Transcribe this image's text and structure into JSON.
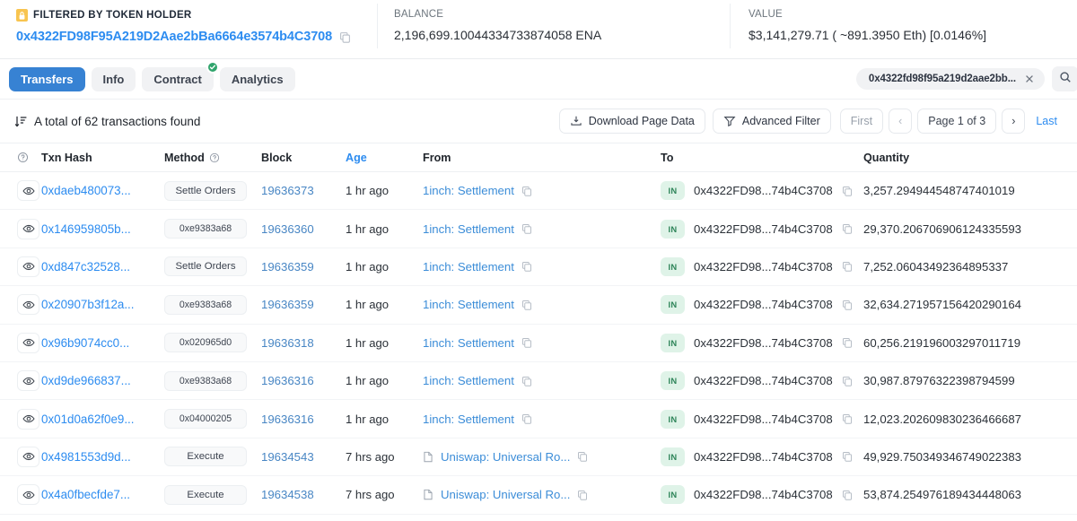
{
  "summary": {
    "filter_label": "FILTERED BY TOKEN HOLDER",
    "filter_address": "0x4322FD98F95A219D2Aae2bBa6664e3574b4C3708",
    "balance_label": "BALANCE",
    "balance_value": "2,196,699.10044334733874058 ENA",
    "value_label": "VALUE",
    "value_value": "$3,141,279.71 ( ~891.3950 Eth) [0.0146%]"
  },
  "tabs": [
    {
      "label": "Transfers",
      "active": true,
      "verified": false
    },
    {
      "label": "Info",
      "active": false,
      "verified": false
    },
    {
      "label": "Contract",
      "active": false,
      "verified": true
    },
    {
      "label": "Analytics",
      "active": false,
      "verified": false
    }
  ],
  "search": {
    "value": "0x4322fd98f95a219d2aae2bb...",
    "clear_label": "×"
  },
  "toolbar": {
    "total_text": "A total of 62 transactions found",
    "download_label": "Download Page Data",
    "advanced_filter_label": "Advanced Filter",
    "first_label": "First",
    "prev_label": "‹",
    "page_label": "Page 1 of 3",
    "next_label": "›",
    "last_label": "Last"
  },
  "table": {
    "columns": [
      "",
      "Txn Hash",
      "Method",
      "Block",
      "Age",
      "From",
      "To",
      "Quantity"
    ],
    "rows": [
      {
        "hash": "0xdaeb480073...",
        "method": "Settle Orders",
        "method_hex": false,
        "block": "19636373",
        "age": "1 hr ago",
        "from": "1inch: Settlement",
        "from_doc": false,
        "direction": "IN",
        "to": "0x4322FD98...74b4C3708",
        "quantity": "3,257.294944548747401019"
      },
      {
        "hash": "0x146959805b...",
        "method": "0xe9383a68",
        "method_hex": true,
        "block": "19636360",
        "age": "1 hr ago",
        "from": "1inch: Settlement",
        "from_doc": false,
        "direction": "IN",
        "to": "0x4322FD98...74b4C3708",
        "quantity": "29,370.206706906124335593"
      },
      {
        "hash": "0xd847c32528...",
        "method": "Settle Orders",
        "method_hex": false,
        "block": "19636359",
        "age": "1 hr ago",
        "from": "1inch: Settlement",
        "from_doc": false,
        "direction": "IN",
        "to": "0x4322FD98...74b4C3708",
        "quantity": "7,252.06043492364895337"
      },
      {
        "hash": "0x20907b3f12a...",
        "method": "0xe9383a68",
        "method_hex": true,
        "block": "19636359",
        "age": "1 hr ago",
        "from": "1inch: Settlement",
        "from_doc": false,
        "direction": "IN",
        "to": "0x4322FD98...74b4C3708",
        "quantity": "32,634.271957156420290164"
      },
      {
        "hash": "0x96b9074cc0...",
        "method": "0x020965d0",
        "method_hex": true,
        "block": "19636318",
        "age": "1 hr ago",
        "from": "1inch: Settlement",
        "from_doc": false,
        "direction": "IN",
        "to": "0x4322FD98...74b4C3708",
        "quantity": "60,256.219196003297011719"
      },
      {
        "hash": "0xd9de966837...",
        "method": "0xe9383a68",
        "method_hex": true,
        "block": "19636316",
        "age": "1 hr ago",
        "from": "1inch: Settlement",
        "from_doc": false,
        "direction": "IN",
        "to": "0x4322FD98...74b4C3708",
        "quantity": "30,987.87976322398794599"
      },
      {
        "hash": "0x01d0a62f0e9...",
        "method": "0x04000205",
        "method_hex": true,
        "block": "19636316",
        "age": "1 hr ago",
        "from": "1inch: Settlement",
        "from_doc": false,
        "direction": "IN",
        "to": "0x4322FD98...74b4C3708",
        "quantity": "12,023.202609830236466687"
      },
      {
        "hash": "0x4981553d9d...",
        "method": "Execute",
        "method_hex": false,
        "block": "19634543",
        "age": "7 hrs ago",
        "from": "Uniswap: Universal Ro...",
        "from_doc": true,
        "direction": "IN",
        "to": "0x4322FD98...74b4C3708",
        "quantity": "49,929.750349346749022383"
      },
      {
        "hash": "0x4a0fbecfde7...",
        "method": "Execute",
        "method_hex": false,
        "block": "19634538",
        "age": "7 hrs ago",
        "from": "Uniswap: Universal Ro...",
        "from_doc": true,
        "direction": "IN",
        "to": "0x4322FD98...74b4C3708",
        "quantity": "53,874.254976189434448063"
      }
    ]
  },
  "colors": {
    "accent": "#2d8cf0",
    "tab_active": "#3782d3",
    "verified": "#30a46c",
    "in_badge_bg": "#dff3e8",
    "in_badge_fg": "#2f855a",
    "lock_badge": "#f8c44f"
  }
}
